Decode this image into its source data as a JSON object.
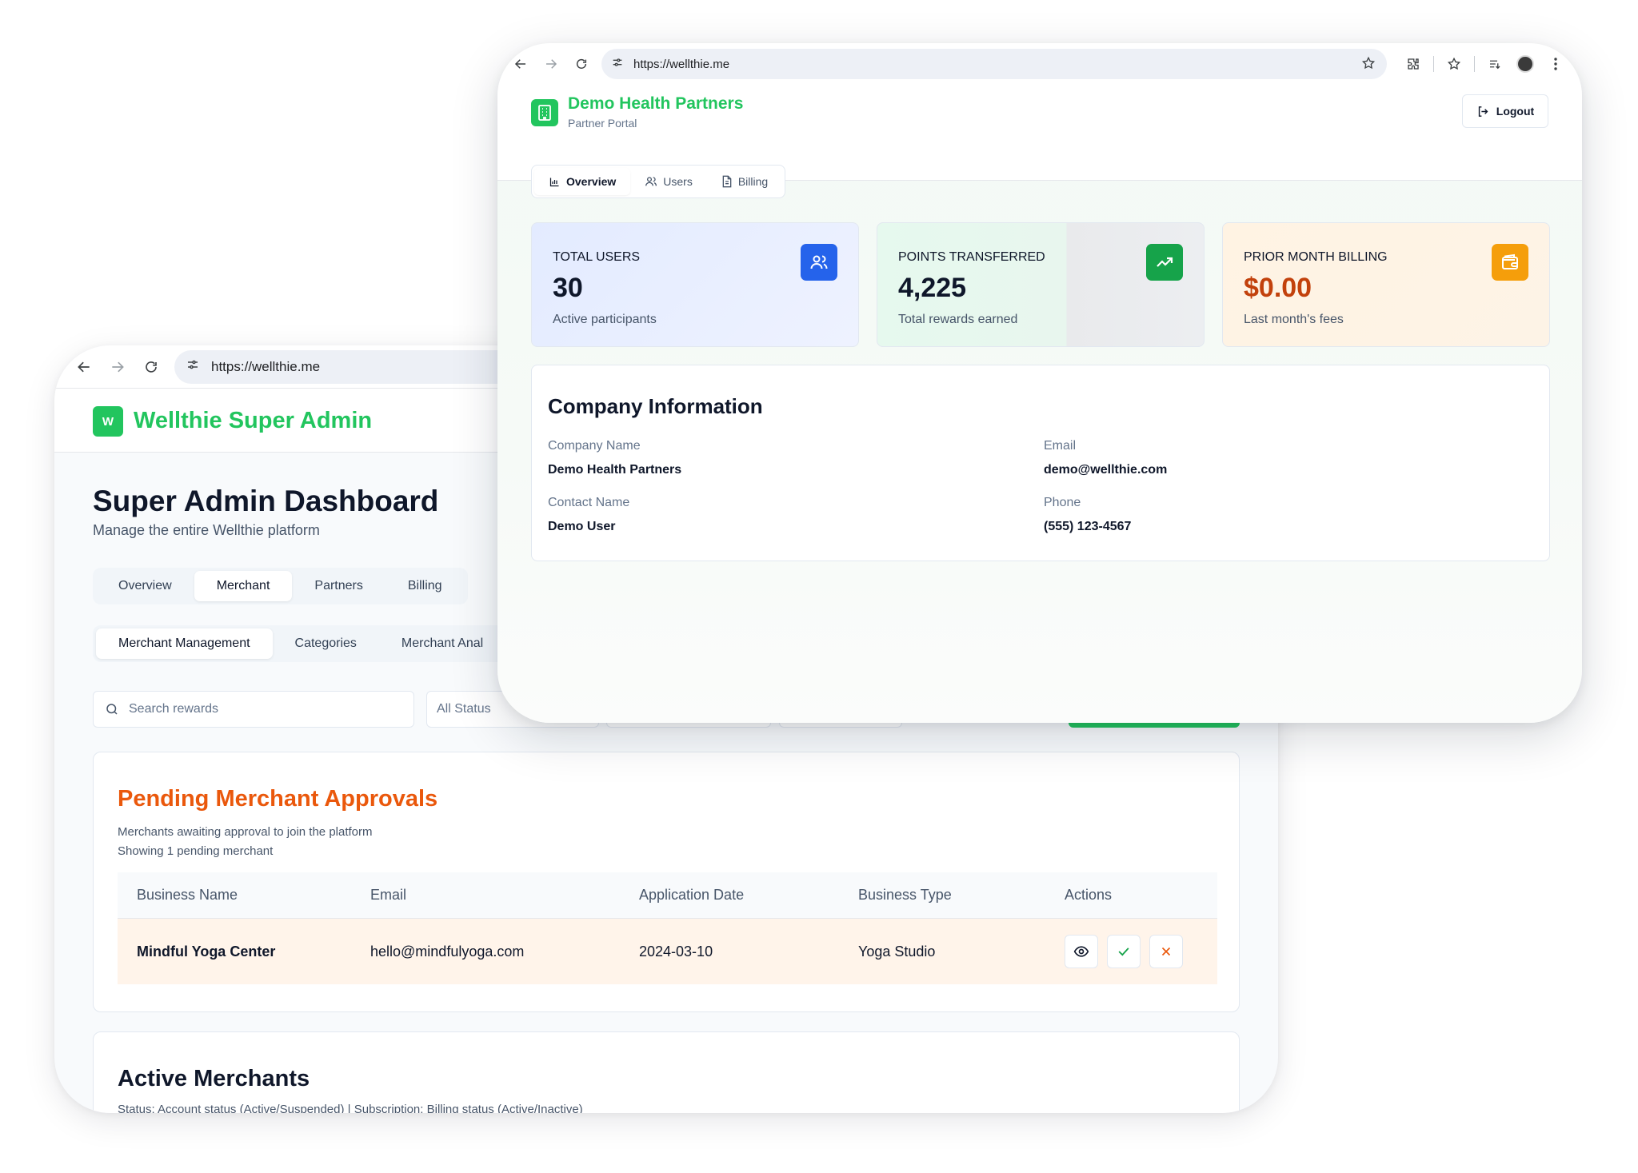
{
  "admin_window": {
    "url": "https://wellthie.me",
    "logo_letter": "W",
    "brand": "Wellthie Super Admin",
    "title": "Super Admin Dashboard",
    "subtitle": "Manage the entire Wellthie platform",
    "main_tabs": [
      {
        "label": "Overview",
        "active": false
      },
      {
        "label": "Merchant",
        "active": true
      },
      {
        "label": "Partners",
        "active": false
      },
      {
        "label": "Billing",
        "active": false
      }
    ],
    "sub_tabs": [
      {
        "label": "Merchant Management",
        "active": true
      },
      {
        "label": "Categories",
        "active": false
      },
      {
        "label": "Merchant Anal",
        "active": false
      }
    ],
    "search_placeholder": "Search rewards",
    "status_filter": "All Status",
    "pending": {
      "title": "Pending Merchant Approvals",
      "description": "Merchants awaiting approval to join the platform",
      "count_text": "Showing 1 pending merchant",
      "columns": [
        "Business Name",
        "Email",
        "Application Date",
        "Business Type",
        "Actions"
      ],
      "rows": [
        {
          "business_name": "Mindful Yoga Center",
          "email": "hello@mindfulyoga.com",
          "application_date": "2024-03-10",
          "business_type": "Yoga Studio"
        }
      ]
    },
    "active": {
      "title": "Active Merchants",
      "description": "Status: Account status (Active/Suspended) | Subscription: Billing status (Active/Inactive)"
    }
  },
  "partner_window": {
    "url": "https://wellthie.me",
    "brand": "Demo Health Partners",
    "subtitle": "Partner Portal",
    "logout_label": "Logout",
    "tabs": [
      {
        "label": "Overview",
        "icon": "bar-chart-icon",
        "active": true
      },
      {
        "label": "Users",
        "icon": "users-icon",
        "active": false
      },
      {
        "label": "Billing",
        "icon": "document-icon",
        "active": false
      }
    ],
    "stats": [
      {
        "label": "TOTAL USERS",
        "value": "30",
        "note": "Active participants",
        "icon": "users-icon",
        "color": "#2563eb"
      },
      {
        "label": "POINTS TRANSFERRED",
        "value": "4,225",
        "note": "Total rewards earned",
        "icon": "trending-up-icon",
        "color": "#16a34a"
      },
      {
        "label": "PRIOR MONTH BILLING",
        "value": "$0.00",
        "note": "Last month's fees",
        "icon": "wallet-icon",
        "color": "#f59e0b"
      }
    ],
    "company": {
      "title": "Company Information",
      "company_name_label": "Company Name",
      "company_name": "Demo Health Partners",
      "email_label": "Email",
      "email": "demo@wellthie.com",
      "contact_label": "Contact Name",
      "contact": "Demo User",
      "phone_label": "Phone",
      "phone": "(555) 123-4567"
    }
  },
  "colors": {
    "brand_green": "#22c55e",
    "pending_orange": "#ea580c",
    "billing_orange": "#c2410c",
    "users_blue": "#2563eb"
  }
}
